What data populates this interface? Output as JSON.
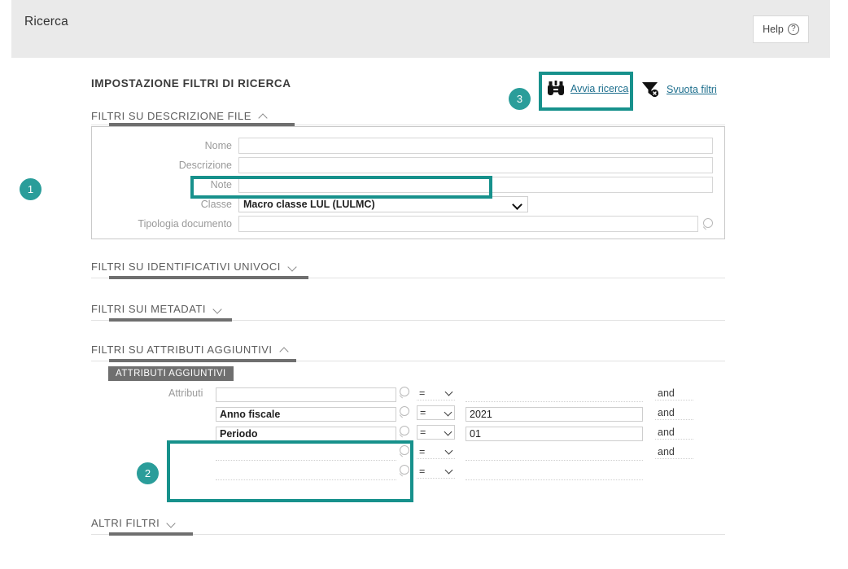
{
  "header": {
    "title": "Ricerca",
    "help_label": "Help",
    "help_icon": "question-circle-icon"
  },
  "page": {
    "heading": "IMPOSTAZIONE FILTRI DI RICERCA"
  },
  "toolbar": {
    "actions": [
      {
        "label": "Avvia ricerca",
        "icon": "binoculars-icon",
        "highlighted": true,
        "step": "3"
      },
      {
        "label": "Svuota filtri",
        "icon": "funnel-clear-icon",
        "highlighted": false
      }
    ]
  },
  "sections": [
    {
      "label": "FILTRI SU DESCRIZIONE FILE",
      "expanded": true,
      "chevron": "chevron-up-icon"
    },
    {
      "label": "FILTRI SU IDENTIFICATIVI UNIVOCI",
      "expanded": false,
      "chevron": "chevron-down-icon"
    },
    {
      "label": "FILTRI SUI METADATI",
      "expanded": false,
      "chevron": "chevron-down-icon"
    },
    {
      "label": "FILTRI SU ATTRIBUTI AGGIUNTIVI",
      "expanded": true,
      "chevron": "chevron-up-icon"
    },
    {
      "label": "ALTRI FILTRI",
      "expanded": false,
      "chevron": "chevron-down-icon"
    }
  ],
  "descrizione_file": {
    "fields": [
      {
        "label": "Nome",
        "value": "",
        "type": "text"
      },
      {
        "label": "Descrizione",
        "value": "",
        "type": "text"
      },
      {
        "label": "Note",
        "value": "",
        "type": "text"
      },
      {
        "label": "Classe",
        "value": "Macro classe LUL (LULMC)",
        "type": "select",
        "step": "1"
      },
      {
        "label": "Tipologia documento",
        "value": "",
        "type": "lookup",
        "icon": "magnifier-icon"
      }
    ]
  },
  "attributi_aggiuntivi": {
    "tab_label": "ATTRIBUTI AGGIUNTIVI",
    "attributi_label": "Attributi",
    "step": "2",
    "rows": [
      {
        "name": "",
        "operator": "=",
        "value": "",
        "conjunction": "and",
        "name_filled": false,
        "value_filled": false,
        "has_conjunction": true
      },
      {
        "name": "Anno fiscale",
        "operator": "=",
        "value": "2021",
        "conjunction": "and",
        "name_filled": true,
        "value_filled": true,
        "has_conjunction": true
      },
      {
        "name": "Periodo",
        "operator": "=",
        "value": "01",
        "conjunction": "and",
        "name_filled": true,
        "value_filled": true,
        "has_conjunction": true
      },
      {
        "name": "",
        "operator": "=",
        "value": "",
        "conjunction": "and",
        "name_filled": false,
        "value_filled": false,
        "has_conjunction": true
      },
      {
        "name": "",
        "operator": "=",
        "value": "",
        "conjunction": "",
        "name_filled": false,
        "value_filled": false,
        "has_conjunction": false
      }
    ]
  },
  "colors": {
    "accent_teal": "#17918c",
    "badge_teal": "#2a9d9a",
    "link_blue": "#1b6d8c",
    "header_gray": "#eaeaea",
    "rule_dark": "#6f6f6f"
  }
}
